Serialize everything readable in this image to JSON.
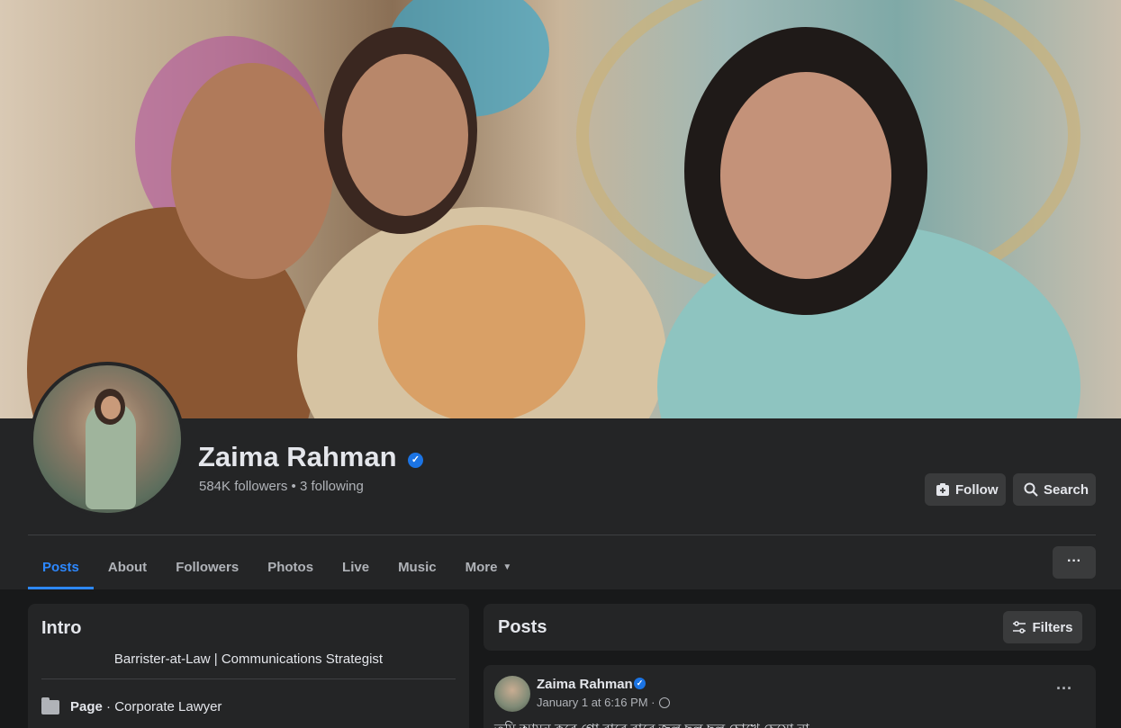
{
  "profile": {
    "name": "Zaima Rahman",
    "verified_mark": "✓",
    "stats": "584K followers • 3 following"
  },
  "actions": {
    "follow_label": "Follow",
    "search_label": "Search"
  },
  "tabs": [
    {
      "label": "Posts",
      "active": true
    },
    {
      "label": "About"
    },
    {
      "label": "Followers"
    },
    {
      "label": "Photos"
    },
    {
      "label": "Live"
    },
    {
      "label": "Music"
    },
    {
      "label": "More"
    }
  ],
  "more_menu_icon": "···",
  "intro": {
    "title": "Intro",
    "bio": "Barrister-at-Law | Communications Strategist",
    "page_label": "Page",
    "page_category": " · Corporate Lawyer"
  },
  "posts": {
    "title": "Posts",
    "filters_label": "Filters"
  },
  "post": {
    "author": "Zaima Rahman",
    "verified_mark": "✓",
    "meta": "January 1 at 6:16 PM ·",
    "menu_icon": "···",
    "text": "তুমি আমন করে গো বারে বারে জল ছল ছল চোখে চেয়ো না"
  },
  "colors": {
    "accent": "#2d88ff",
    "verified": "#1b74e4",
    "background": "#18191a",
    "card": "#242526"
  },
  "icons": {
    "follow": "follow-icon",
    "search": "search-icon",
    "filters": "sliders-icon",
    "caret": "caret-down-icon",
    "globe": "globe-icon",
    "page": "folder-icon"
  }
}
